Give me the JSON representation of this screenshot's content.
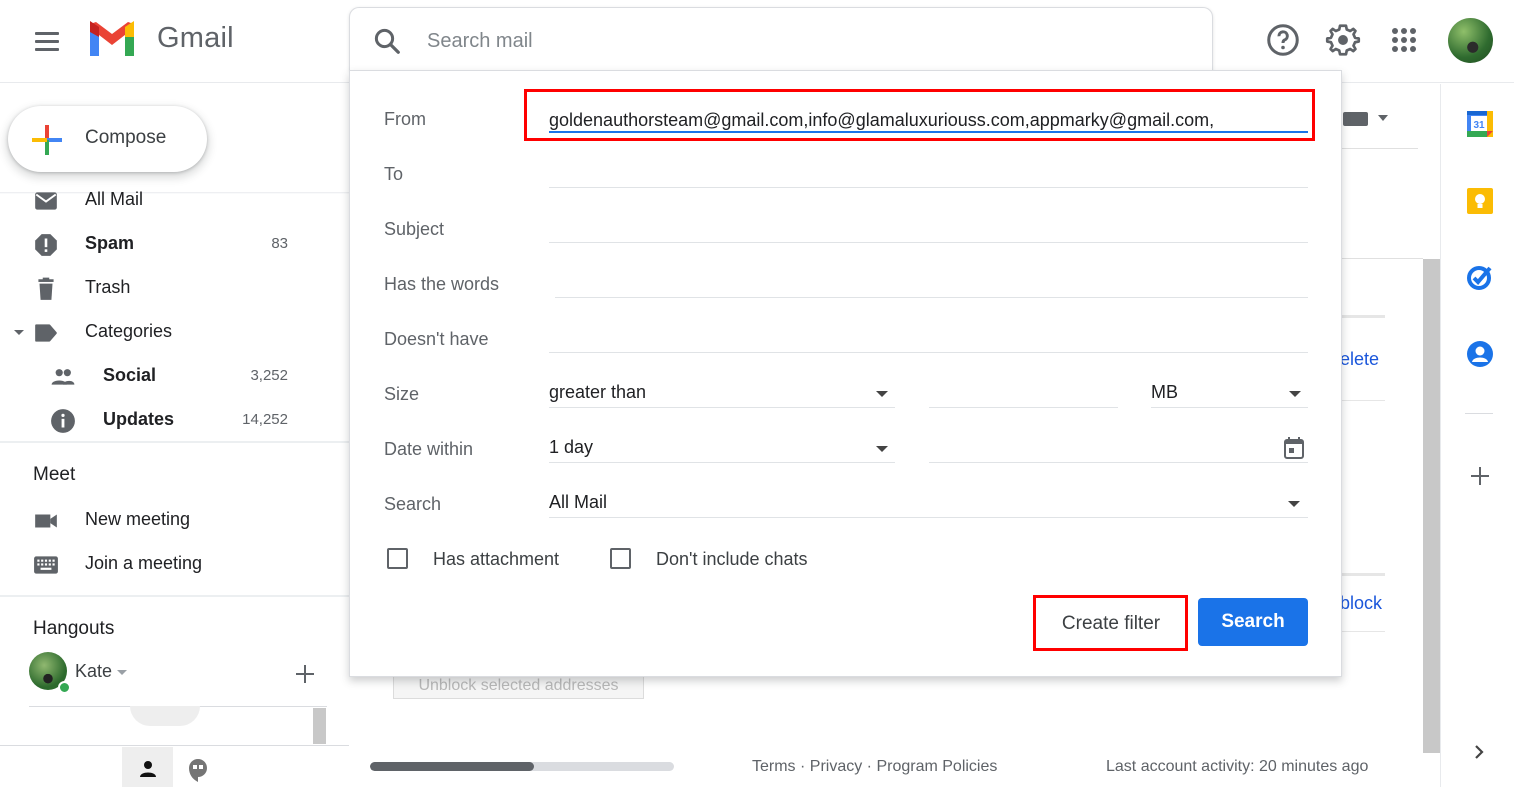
{
  "app": {
    "name": "Gmail"
  },
  "header": {
    "search_placeholder": "Search mail",
    "icons": [
      "help-icon",
      "settings-icon",
      "apps-grid-icon",
      "account-avatar"
    ]
  },
  "sidebar": {
    "compose_label": "Compose",
    "items": [
      {
        "label": "All Mail",
        "count": "",
        "icon": "mail-icon",
        "bold": false
      },
      {
        "label": "Spam",
        "count": "83",
        "icon": "spam-icon",
        "bold": true
      },
      {
        "label": "Trash",
        "count": "",
        "icon": "trash-icon",
        "bold": false
      },
      {
        "label": "Categories",
        "count": "",
        "icon": "label-icon",
        "bold": false
      },
      {
        "label": "Social",
        "count": "3,252",
        "icon": "people-icon",
        "bold": true
      },
      {
        "label": "Updates",
        "count": "14,252",
        "icon": "info-icon",
        "bold": true
      }
    ],
    "meet": {
      "title": "Meet",
      "items": [
        {
          "label": "New meeting",
          "icon": "video-camera-icon"
        },
        {
          "label": "Join a meeting",
          "icon": "keyboard-icon"
        }
      ]
    },
    "hangouts": {
      "title": "Hangouts",
      "user": "Kate"
    }
  },
  "filter": {
    "from_label": "From",
    "from_value": "goldenauthorsteam@gmail.com,info@glamaluxuriouss.com,appmarky@gmail.com,",
    "to_label": "To",
    "to_value": "",
    "subject_label": "Subject",
    "subject_value": "",
    "has_words_label": "Has the words",
    "has_words_value": "",
    "doesnt_have_label": "Doesn't have",
    "doesnt_have_value": "",
    "size_label": "Size",
    "size_operator": "greater than",
    "size_value": "",
    "size_unit": "MB",
    "date_label": "Date within",
    "date_value": "1 day",
    "date_input": "",
    "search_label": "Search",
    "search_scope": "All Mail",
    "has_attachment_label": "Has attachment",
    "has_attachment_checked": false,
    "no_chats_label": "Don't include chats",
    "no_chats_checked": false,
    "create_filter_label": "Create filter",
    "search_button_label": "Search"
  },
  "background": {
    "link_delete_fragment": "elete",
    "link_unblock_fragment": "block",
    "unblock_button_label": "Unblock selected addresses"
  },
  "footer": {
    "storage_used_fraction": 0.54,
    "links": "Terms · Privacy · Program Policies",
    "activity": "Last account activity: 20 minutes ago"
  },
  "side_panel": {
    "calendar_day": "31",
    "icons": [
      "calendar-icon",
      "keep-icon",
      "tasks-icon",
      "contacts-icon",
      "add-addon-icon",
      "expand-panel-icon"
    ]
  },
  "colors": {
    "primary_blue": "#1a73e8",
    "highlight_red": "#ff0000",
    "link_blue": "#1a56db"
  }
}
